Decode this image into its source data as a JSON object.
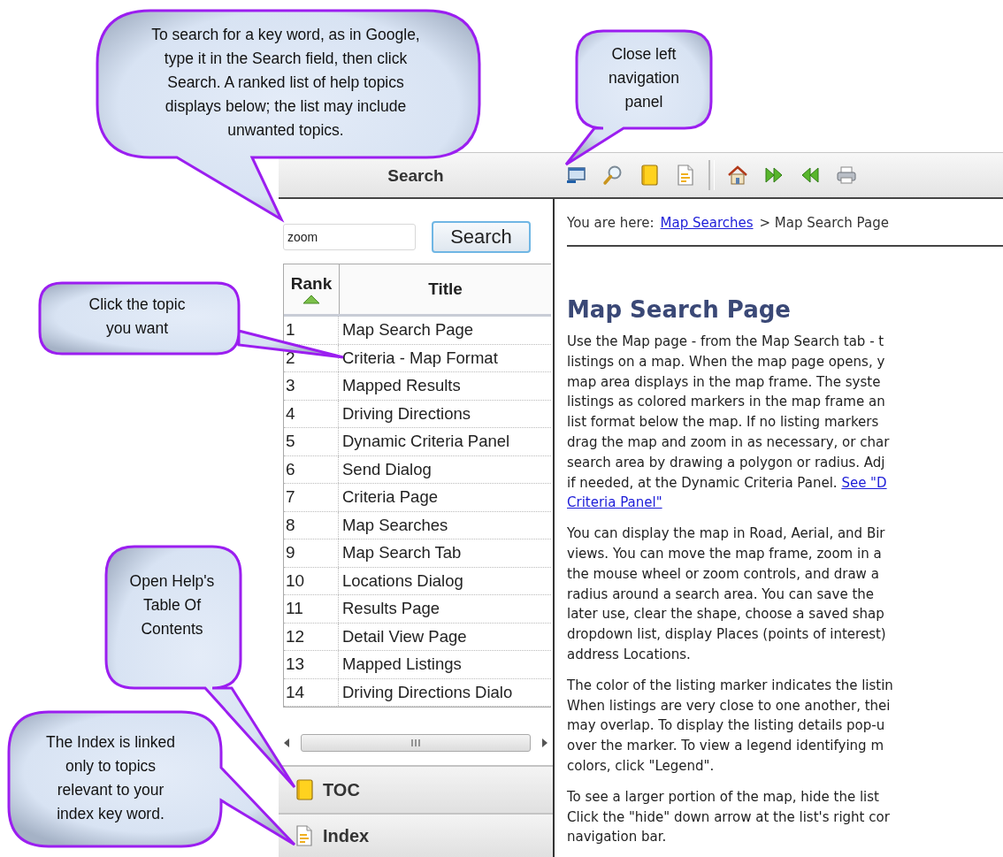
{
  "callouts": [
    {
      "text": "To search for a key word, as in Google, type it in the Search field, then click Search. A ranked list of help topics displays below; the list may include unwanted topics."
    },
    {
      "text": "Close left navigation panel"
    },
    {
      "text": "Click the topic you want"
    },
    {
      "text": "Open Help's Table Of Contents"
    },
    {
      "text": "The Index is linked only to topics relevant to your index key word."
    }
  ],
  "toolbar": {
    "panel_title": "Search"
  },
  "search": {
    "value": "zoom",
    "button": "Search"
  },
  "results": {
    "columns": [
      "Rank",
      "Title"
    ],
    "rows": [
      {
        "rank": "1",
        "title": "Map Search Page"
      },
      {
        "rank": "2",
        "title": "Criteria - Map Format"
      },
      {
        "rank": "3",
        "title": "Mapped Results"
      },
      {
        "rank": "4",
        "title": "Driving Directions"
      },
      {
        "rank": "5",
        "title": "Dynamic Criteria Panel"
      },
      {
        "rank": "6",
        "title": "Send Dialog"
      },
      {
        "rank": "7",
        "title": "Criteria Page"
      },
      {
        "rank": "8",
        "title": "Map Searches"
      },
      {
        "rank": "9",
        "title": "Map Search Tab"
      },
      {
        "rank": "10",
        "title": "Locations Dialog"
      },
      {
        "rank": "11",
        "title": "Results Page"
      },
      {
        "rank": "12",
        "title": "Detail View Page"
      },
      {
        "rank": "13",
        "title": "Mapped Listings"
      },
      {
        "rank": "14",
        "title": "Driving Directions Dialo"
      }
    ]
  },
  "nav_tabs": [
    {
      "label": "TOC"
    },
    {
      "label": "Index"
    }
  ],
  "content": {
    "breadcrumb": {
      "prefix": "You are here:",
      "link": "Map Searches",
      "current": "> Map Search Page"
    },
    "heading": "Map Search Page",
    "paragraphs": [
      [
        {
          "text": "Use the Map page - from the Map Search tab - t"
        },
        {
          "text": "listings on a map. When the map page opens, y"
        },
        {
          "text": "map area displays in the map frame. The syste"
        },
        {
          "text": "listings as colored markers in the map frame an"
        },
        {
          "text": "list format below the map. If no listing markers"
        },
        {
          "text": "drag the map and zoom in as necessary, or char"
        },
        {
          "text": "search area by drawing a polygon or radius. Adj"
        },
        {
          "text": "if needed, at the Dynamic Criteria Panel.",
          "link": "See \"D"
        },
        {
          "link": "Criteria Panel\""
        }
      ],
      [
        {
          "text": "You can display the map in Road, Aerial, and Bir"
        },
        {
          "text": "views. You can move the map frame, zoom in a"
        },
        {
          "text": "the mouse wheel or zoom controls, and draw a"
        },
        {
          "text": "radius around a search area. You can save the"
        },
        {
          "text": "later use, clear the shape, choose a saved shap"
        },
        {
          "text": "dropdown list, display Places (points of interest)"
        },
        {
          "text": "address Locations."
        }
      ],
      [
        {
          "text": "The color of the listing marker indicates the listin"
        },
        {
          "text": "When listings are very close to one another, thei"
        },
        {
          "text": "may overlap. To display the listing details pop-u"
        },
        {
          "text": "over the marker. To view a legend identifying m"
        },
        {
          "text": "colors, click \"Legend\"."
        }
      ],
      [
        {
          "text": "To see a larger portion of the map, hide the list"
        },
        {
          "text": "Click the \"hide\" down arrow at the list's right cor"
        },
        {
          "text": "navigation bar."
        }
      ]
    ]
  }
}
